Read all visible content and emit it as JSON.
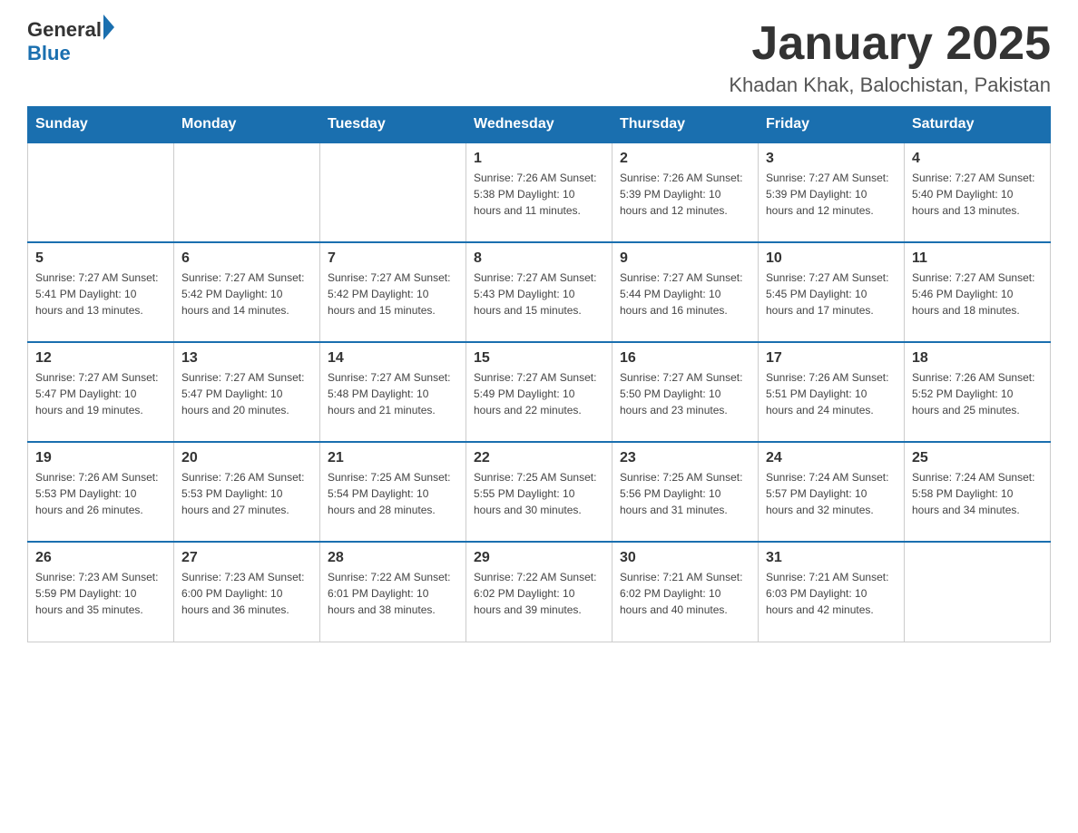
{
  "header": {
    "title": "January 2025",
    "subtitle": "Khadan Khak, Balochistan, Pakistan",
    "logo_general": "General",
    "logo_blue": "Blue"
  },
  "days_of_week": [
    "Sunday",
    "Monday",
    "Tuesday",
    "Wednesday",
    "Thursday",
    "Friday",
    "Saturday"
  ],
  "weeks": [
    {
      "days": [
        {
          "number": "",
          "info": ""
        },
        {
          "number": "",
          "info": ""
        },
        {
          "number": "",
          "info": ""
        },
        {
          "number": "1",
          "info": "Sunrise: 7:26 AM\nSunset: 5:38 PM\nDaylight: 10 hours\nand 11 minutes."
        },
        {
          "number": "2",
          "info": "Sunrise: 7:26 AM\nSunset: 5:39 PM\nDaylight: 10 hours\nand 12 minutes."
        },
        {
          "number": "3",
          "info": "Sunrise: 7:27 AM\nSunset: 5:39 PM\nDaylight: 10 hours\nand 12 minutes."
        },
        {
          "number": "4",
          "info": "Sunrise: 7:27 AM\nSunset: 5:40 PM\nDaylight: 10 hours\nand 13 minutes."
        }
      ]
    },
    {
      "days": [
        {
          "number": "5",
          "info": "Sunrise: 7:27 AM\nSunset: 5:41 PM\nDaylight: 10 hours\nand 13 minutes."
        },
        {
          "number": "6",
          "info": "Sunrise: 7:27 AM\nSunset: 5:42 PM\nDaylight: 10 hours\nand 14 minutes."
        },
        {
          "number": "7",
          "info": "Sunrise: 7:27 AM\nSunset: 5:42 PM\nDaylight: 10 hours\nand 15 minutes."
        },
        {
          "number": "8",
          "info": "Sunrise: 7:27 AM\nSunset: 5:43 PM\nDaylight: 10 hours\nand 15 minutes."
        },
        {
          "number": "9",
          "info": "Sunrise: 7:27 AM\nSunset: 5:44 PM\nDaylight: 10 hours\nand 16 minutes."
        },
        {
          "number": "10",
          "info": "Sunrise: 7:27 AM\nSunset: 5:45 PM\nDaylight: 10 hours\nand 17 minutes."
        },
        {
          "number": "11",
          "info": "Sunrise: 7:27 AM\nSunset: 5:46 PM\nDaylight: 10 hours\nand 18 minutes."
        }
      ]
    },
    {
      "days": [
        {
          "number": "12",
          "info": "Sunrise: 7:27 AM\nSunset: 5:47 PM\nDaylight: 10 hours\nand 19 minutes."
        },
        {
          "number": "13",
          "info": "Sunrise: 7:27 AM\nSunset: 5:47 PM\nDaylight: 10 hours\nand 20 minutes."
        },
        {
          "number": "14",
          "info": "Sunrise: 7:27 AM\nSunset: 5:48 PM\nDaylight: 10 hours\nand 21 minutes."
        },
        {
          "number": "15",
          "info": "Sunrise: 7:27 AM\nSunset: 5:49 PM\nDaylight: 10 hours\nand 22 minutes."
        },
        {
          "number": "16",
          "info": "Sunrise: 7:27 AM\nSunset: 5:50 PM\nDaylight: 10 hours\nand 23 minutes."
        },
        {
          "number": "17",
          "info": "Sunrise: 7:26 AM\nSunset: 5:51 PM\nDaylight: 10 hours\nand 24 minutes."
        },
        {
          "number": "18",
          "info": "Sunrise: 7:26 AM\nSunset: 5:52 PM\nDaylight: 10 hours\nand 25 minutes."
        }
      ]
    },
    {
      "days": [
        {
          "number": "19",
          "info": "Sunrise: 7:26 AM\nSunset: 5:53 PM\nDaylight: 10 hours\nand 26 minutes."
        },
        {
          "number": "20",
          "info": "Sunrise: 7:26 AM\nSunset: 5:53 PM\nDaylight: 10 hours\nand 27 minutes."
        },
        {
          "number": "21",
          "info": "Sunrise: 7:25 AM\nSunset: 5:54 PM\nDaylight: 10 hours\nand 28 minutes."
        },
        {
          "number": "22",
          "info": "Sunrise: 7:25 AM\nSunset: 5:55 PM\nDaylight: 10 hours\nand 30 minutes."
        },
        {
          "number": "23",
          "info": "Sunrise: 7:25 AM\nSunset: 5:56 PM\nDaylight: 10 hours\nand 31 minutes."
        },
        {
          "number": "24",
          "info": "Sunrise: 7:24 AM\nSunset: 5:57 PM\nDaylight: 10 hours\nand 32 minutes."
        },
        {
          "number": "25",
          "info": "Sunrise: 7:24 AM\nSunset: 5:58 PM\nDaylight: 10 hours\nand 34 minutes."
        }
      ]
    },
    {
      "days": [
        {
          "number": "26",
          "info": "Sunrise: 7:23 AM\nSunset: 5:59 PM\nDaylight: 10 hours\nand 35 minutes."
        },
        {
          "number": "27",
          "info": "Sunrise: 7:23 AM\nSunset: 6:00 PM\nDaylight: 10 hours\nand 36 minutes."
        },
        {
          "number": "28",
          "info": "Sunrise: 7:22 AM\nSunset: 6:01 PM\nDaylight: 10 hours\nand 38 minutes."
        },
        {
          "number": "29",
          "info": "Sunrise: 7:22 AM\nSunset: 6:02 PM\nDaylight: 10 hours\nand 39 minutes."
        },
        {
          "number": "30",
          "info": "Sunrise: 7:21 AM\nSunset: 6:02 PM\nDaylight: 10 hours\nand 40 minutes."
        },
        {
          "number": "31",
          "info": "Sunrise: 7:21 AM\nSunset: 6:03 PM\nDaylight: 10 hours\nand 42 minutes."
        },
        {
          "number": "",
          "info": ""
        }
      ]
    }
  ]
}
